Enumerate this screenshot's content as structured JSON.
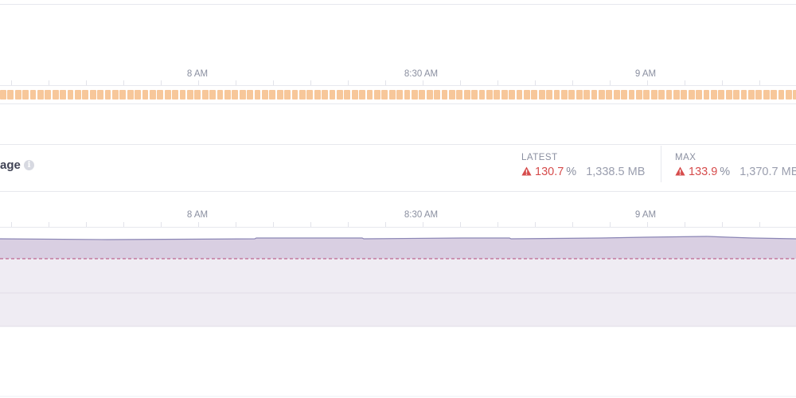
{
  "timeline": {
    "tick_labels": [
      "8 AM",
      "8:30 AM",
      "9 AM"
    ]
  },
  "memory_section": {
    "title_fragment": "age",
    "info_icon": "info-icon",
    "latest": {
      "caption": "LATEST",
      "icon": "warning-icon",
      "percent": "130.7",
      "percent_unit": "%",
      "absolute": "1,338.5 MB"
    },
    "max": {
      "caption": "MAX",
      "icon": "warning-icon",
      "percent": "133.9",
      "percent_unit": "%",
      "absolute": "1,370.7 MB"
    }
  },
  "colors": {
    "event_strip": "#f7c79a",
    "warning": "#d64c4c",
    "memory_fill": "#d9cfe2",
    "quota_fill": "#efecf3",
    "memory_line": "#8b86b5",
    "quota_line": "#b5477a"
  }
}
